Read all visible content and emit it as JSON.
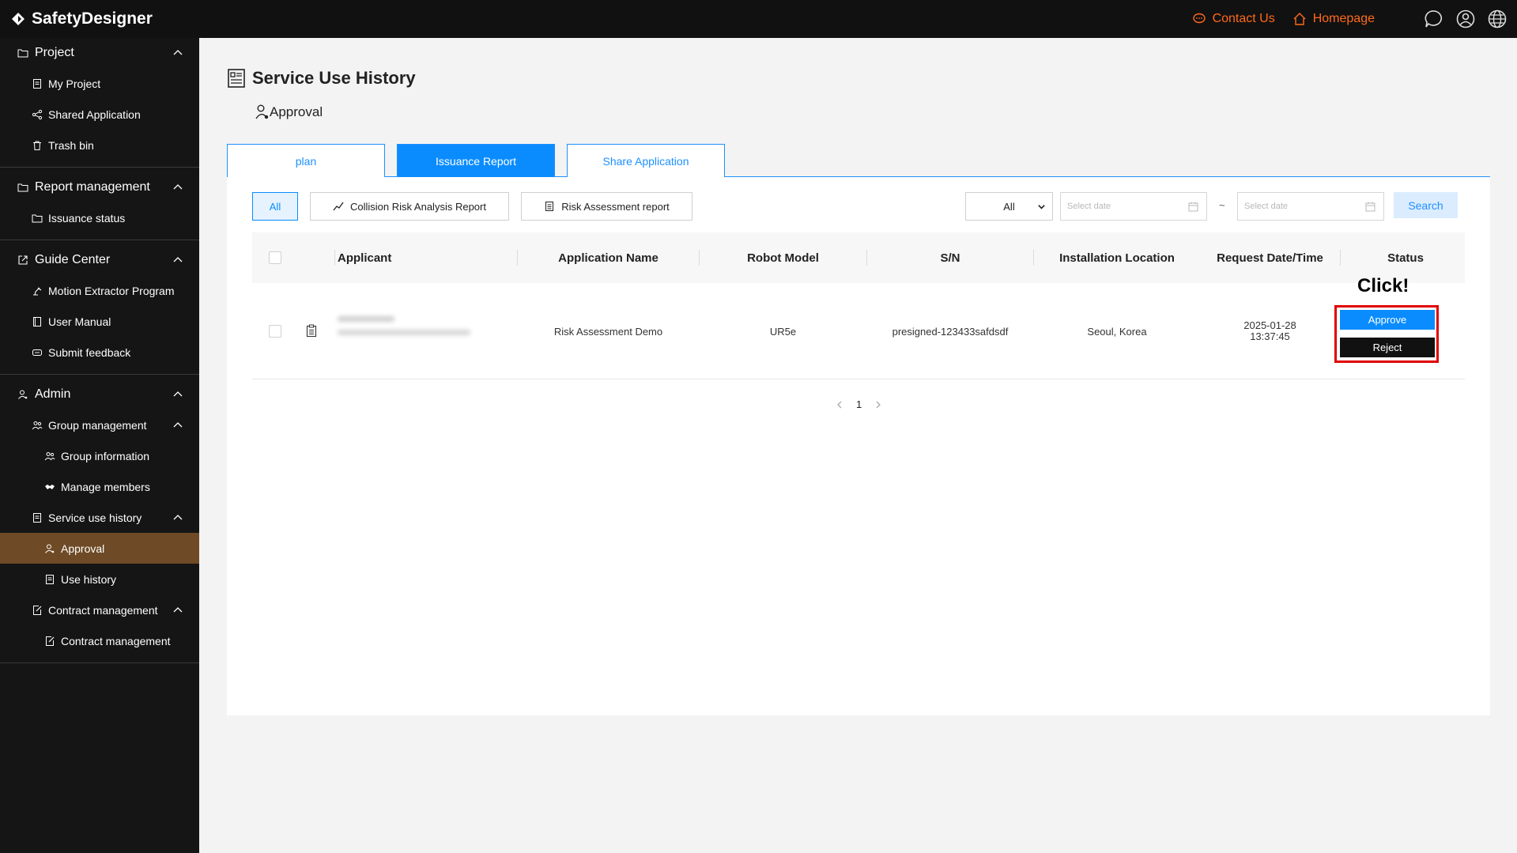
{
  "app": {
    "brand": "SafetyDesigner"
  },
  "topbar": {
    "contact_label": "Contact Us",
    "homepage_label": "Homepage",
    "accent_color": "#ff6a1a"
  },
  "sidebar": {
    "project": {
      "title": "Project",
      "items": [
        "My Project",
        "Shared Application",
        "Trash bin"
      ]
    },
    "report": {
      "title": "Report management",
      "items": [
        "Issuance status"
      ]
    },
    "guide": {
      "title": "Guide Center",
      "items": [
        "Motion Extractor Program",
        "User Manual",
        "Submit feedback"
      ]
    },
    "admin": {
      "title": "Admin",
      "group": {
        "title": "Group management",
        "items": [
          "Group information",
          "Manage members"
        ]
      },
      "service": {
        "title": "Service use history",
        "items": [
          "Approval",
          "Use history"
        ]
      },
      "contract": {
        "title": "Contract management",
        "items": [
          "Contract management"
        ]
      }
    },
    "active_color": "#6e4a26"
  },
  "page": {
    "title": "Service Use History",
    "subtitle": "Approval"
  },
  "tabs": [
    {
      "label": "plan",
      "active": false
    },
    {
      "label": "Issuance Report",
      "active": true
    },
    {
      "label": "Share Application",
      "active": false
    }
  ],
  "filters": {
    "all": "All",
    "collision": "Collision Risk Analysis Report",
    "risk": "Risk Assessment report",
    "select_value": "All",
    "date_placeholder_from": "Select date",
    "date_placeholder_to": "Select date",
    "range_separator": "~",
    "search": "Search"
  },
  "table": {
    "headers": [
      "Applicant",
      "Application Name",
      "Robot Model",
      "S/N",
      "Installation Location",
      "Request Date/Time",
      "Status"
    ],
    "rows": [
      {
        "application_name": "Risk Assessment Demo",
        "robot_model": "UR5e",
        "sn": "presigned-123433safdsdf",
        "location": "Seoul, Korea",
        "date": "2025-01-28",
        "time": "13:37:45",
        "approve": "Approve",
        "reject": "Reject"
      }
    ]
  },
  "annotation": {
    "click": "Click!",
    "color": "#e00000"
  },
  "pagination": {
    "current": "1"
  }
}
